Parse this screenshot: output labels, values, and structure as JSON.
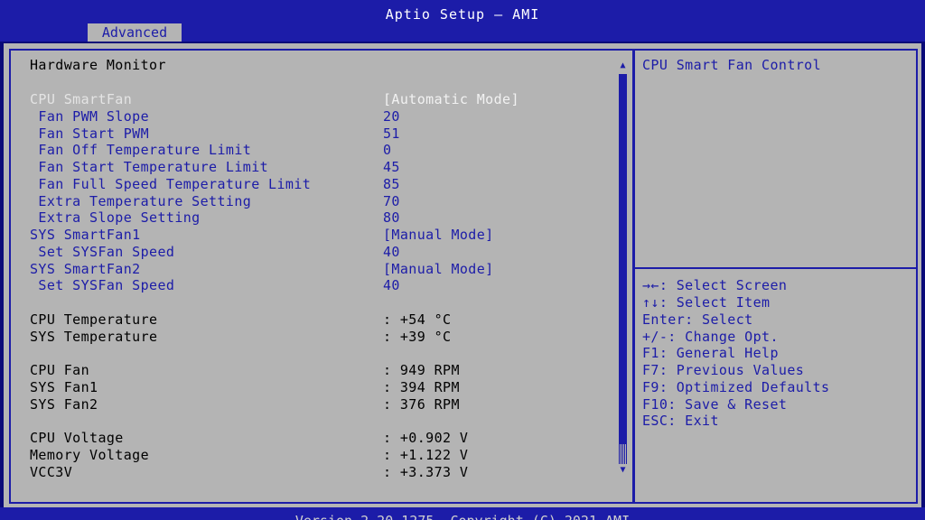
{
  "header": {
    "title": "Aptio Setup – AMI",
    "active_tab": "Advanced"
  },
  "panel": {
    "section_title": "Hardware Monitor",
    "settings": [
      {
        "label": "CPU SmartFan",
        "value": "[Automatic Mode]"
      },
      {
        "label": " Fan PWM Slope",
        "value": "20"
      },
      {
        "label": " Fan Start PWM",
        "value": "51"
      },
      {
        "label": " Fan Off Temperature Limit",
        "value": "0"
      },
      {
        "label": " Fan Start Temperature Limit",
        "value": "45"
      },
      {
        "label": " Fan Full Speed Temperature Limit",
        "value": "85"
      },
      {
        "label": " Extra Temperature Setting",
        "value": "70"
      },
      {
        "label": " Extra Slope Setting",
        "value": "80"
      },
      {
        "label": "SYS SmartFan1",
        "value": "[Manual Mode]"
      },
      {
        "label": " Set SYSFan Speed",
        "value": "40"
      },
      {
        "label": "SYS SmartFan2",
        "value": "[Manual Mode]"
      },
      {
        "label": " Set SYSFan Speed",
        "value": "40"
      }
    ],
    "readings": [
      {
        "label": "CPU Temperature",
        "value": ": +54 °C"
      },
      {
        "label": "SYS Temperature",
        "value": ": +39 °C"
      },
      {
        "label": "CPU Fan",
        "value": ": 949 RPM"
      },
      {
        "label": "SYS Fan1",
        "value": ": 394 RPM"
      },
      {
        "label": "SYS Fan2",
        "value": ": 376 RPM"
      },
      {
        "label": "CPU Voltage",
        "value": ": +0.902 V"
      },
      {
        "label": "Memory Voltage",
        "value": ": +1.122 V"
      },
      {
        "label": "VCC3V",
        "value": ": +3.373 V"
      }
    ]
  },
  "help": {
    "description": "CPU Smart Fan Control",
    "keys": [
      "→←: Select Screen",
      "↑↓: Select Item",
      "Enter: Select",
      "+/-: Change Opt.",
      "F1: General Help",
      "F7: Previous Values",
      "F9: Optimized Defaults",
      "F10: Save & Reset",
      "ESC: Exit"
    ]
  },
  "footer": {
    "version": "Version 2.20.1275. Copyright (C) 2021 AMI"
  },
  "scroll": {
    "up_icon": "▲",
    "down_icon": "▼"
  },
  "colors": {
    "accent": "#1c1ca8",
    "background": "#b4b4b4",
    "selected": "#e4e4e4"
  }
}
